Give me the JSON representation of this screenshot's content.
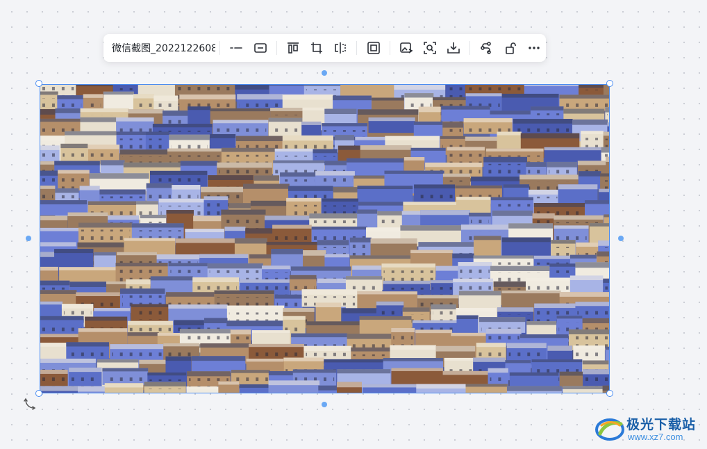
{
  "toolbar": {
    "file_name": "微信截图_2022122608...",
    "buttons": [
      {
        "name": "line-style-icon"
      },
      {
        "name": "border-icon"
      },
      {
        "name": "align-icon"
      },
      {
        "name": "crop-icon"
      },
      {
        "name": "flip-icon"
      },
      {
        "name": "frame-icon"
      },
      {
        "name": "image-edit-icon"
      },
      {
        "name": "image-search-icon"
      },
      {
        "name": "download-icon"
      },
      {
        "name": "connect-icon"
      },
      {
        "name": "unlock-icon"
      },
      {
        "name": "more-icon"
      }
    ]
  },
  "image": {
    "description_name": "city-rooftops-photo",
    "dominant_colors": [
      "#5b6fc8",
      "#c9a77c",
      "#e8e0cf",
      "#3a3a5a",
      "#8b5a3a"
    ]
  },
  "watermark": {
    "title": "极光下载站",
    "url": "www.xz7.com"
  },
  "colors": {
    "selection": "#4a8cf1",
    "canvas_bg": "#f3f4f7"
  }
}
